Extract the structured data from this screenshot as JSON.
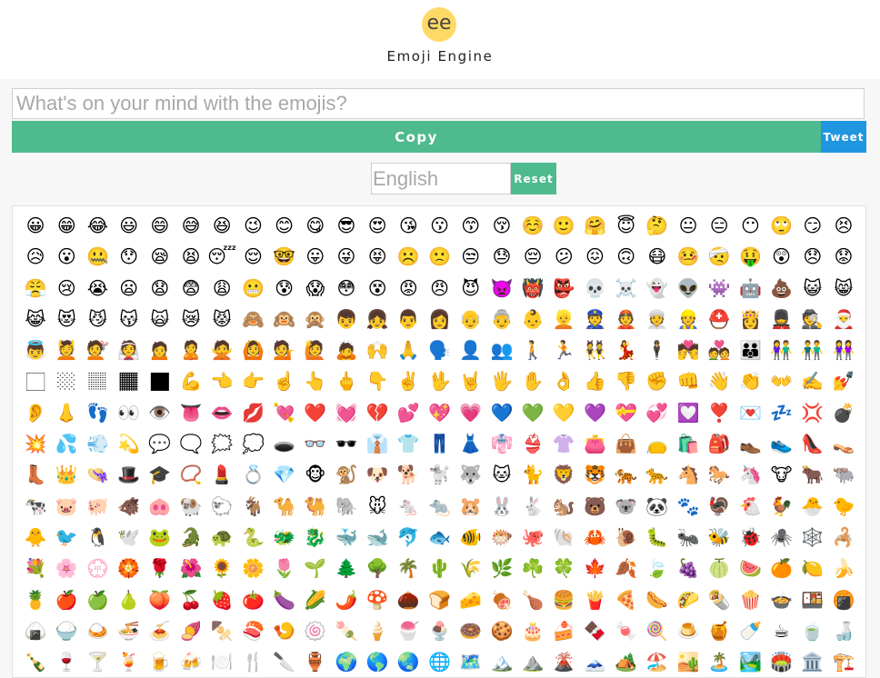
{
  "header": {
    "logo_text": "ee",
    "title": "Emoji Engine"
  },
  "composer": {
    "placeholder": "What's on your mind with the emojis?",
    "copy_label": "Copy",
    "tweet_label": "Tweet"
  },
  "language": {
    "placeholder": "English",
    "reset_label": "Reset"
  },
  "emojis": [
    "😀",
    "😁",
    "😂",
    "😃",
    "😄",
    "😅",
    "😆",
    "😉",
    "😊",
    "😋",
    "😎",
    "😍",
    "😘",
    "😗",
    "😙",
    "😚",
    "☺️",
    "🙂",
    "🤗",
    "😇",
    "🤔",
    "😐",
    "😑",
    "😶",
    "🙄",
    "😏",
    "😣",
    "😥",
    "😮",
    "🤐",
    "😯",
    "😪",
    "😫",
    "😴",
    "😌",
    "🤓",
    "😛",
    "😜",
    "😝",
    "☹️",
    "🙁",
    "😒",
    "😓",
    "😔",
    "😕",
    "😖",
    "🙃",
    "😷",
    "🤒",
    "🤕",
    "🤑",
    "😲",
    "😞",
    "😟",
    "😤",
    "😢",
    "😭",
    "😦",
    "😧",
    "😨",
    "😩",
    "😬",
    "😰",
    "😱",
    "😳",
    "😵",
    "😡",
    "😠",
    "😈",
    "👿",
    "👹",
    "👺",
    "💀",
    "☠️",
    "👻",
    "👽",
    "👾",
    "🤖",
    "💩",
    "😺",
    "😸",
    "😹",
    "😻",
    "😼",
    "😽",
    "🙀",
    "😿",
    "😾",
    "🙈",
    "🙉",
    "🙊",
    "👦",
    "👧",
    "👨",
    "👩",
    "👴",
    "👵",
    "👶",
    "👱",
    "👮",
    "👲",
    "👳",
    "👷",
    "⛑️",
    "👸",
    "💂",
    "🕵️",
    "🎅",
    "👼",
    "💆",
    "💇",
    "👰",
    "🙍",
    "🙎",
    "🙅",
    "🙆",
    "💁",
    "🙋",
    "🙇",
    "🙌",
    "🙏",
    "🗣️",
    "👤",
    "👥",
    "🚶",
    "🏃",
    "👯",
    "💃",
    "🕴️",
    "💏",
    "💑",
    "👪",
    "👫",
    "👬",
    "👭",
    "🏻",
    "🏼",
    "🏽",
    "🏾",
    "🏿",
    "💪",
    "👈",
    "👉",
    "☝️",
    "👆",
    "🖕",
    "👇",
    "✌️",
    "🖖",
    "🤘",
    "🖐️",
    "✋",
    "👌",
    "👍",
    "👎",
    "✊",
    "👊",
    "👋",
    "👏",
    "👐",
    "✍️",
    "💅",
    "👂",
    "👃",
    "👣",
    "👀",
    "👁️",
    "👅",
    "👄",
    "💋",
    "💘",
    "❤️",
    "💓",
    "💔",
    "💕",
    "💖",
    "💗",
    "💙",
    "💚",
    "💛",
    "💜",
    "💝",
    "💞",
    "💟",
    "❣️",
    "💌",
    "💤",
    "💢",
    "💣",
    "💥",
    "💦",
    "💨",
    "💫",
    "💬",
    "🗨️",
    "🗯️",
    "💭",
    "🕳️",
    "👓",
    "🕶️",
    "👔",
    "👕",
    "👖",
    "👗",
    "👘",
    "👙",
    "👚",
    "👛",
    "👜",
    "👝",
    "🛍️",
    "🎒",
    "👞",
    "👟",
    "👠",
    "👡",
    "👢",
    "👑",
    "👒",
    "🎩",
    "🎓",
    "📿",
    "💄",
    "💍",
    "💎",
    "🐵",
    "🐒",
    "🐶",
    "🐕",
    "🐩",
    "🐺",
    "🐱",
    "🐈",
    "🦁",
    "🐯",
    "🐅",
    "🐆",
    "🐴",
    "🐎",
    "🦄",
    "🐮",
    "🐂",
    "🐃",
    "🐄",
    "🐷",
    "🐖",
    "🐗",
    "🐽",
    "🐏",
    "🐑",
    "🐐",
    "🐪",
    "🐫",
    "🐘",
    "🐭",
    "🐁",
    "🐀",
    "🐹",
    "🐰",
    "🐇",
    "🐿️",
    "🐻",
    "🐨",
    "🐼",
    "🐾",
    "🦃",
    "🐔",
    "🐓",
    "🐣",
    "🐤",
    "🐥",
    "🐦",
    "🐧",
    "🕊️",
    "🐸",
    "🐊",
    "🐢",
    "🐍",
    "🐲",
    "🐉",
    "🐳",
    "🐋",
    "🐬",
    "🐟",
    "🐠",
    "🐡",
    "🐙",
    "🐚",
    "🦀",
    "🐌",
    "🐛",
    "🐜",
    "🐝",
    "🐞",
    "🕷️",
    "🕸️",
    "🦂",
    "💐",
    "🌸",
    "💮",
    "🏵️",
    "🌹",
    "🌺",
    "🌻",
    "🌼",
    "🌷",
    "🌱",
    "🌲",
    "🌳",
    "🌴",
    "🌵",
    "🌾",
    "🌿",
    "☘️",
    "🍀",
    "🍁",
    "🍂",
    "🍃",
    "🍇",
    "🍈",
    "🍉",
    "🍊",
    "🍋",
    "🍌",
    "🍍",
    "🍎",
    "🍏",
    "🍐",
    "🍑",
    "🍒",
    "🍓",
    "🍅",
    "🍆",
    "🌽",
    "🌶️",
    "🍄",
    "🌰",
    "🍞",
    "🧀",
    "🍖",
    "🍗",
    "🍔",
    "🍟",
    "🍕",
    "🌭",
    "🌮",
    "🌯",
    "🍿",
    "🍲",
    "🍱",
    "🍘",
    "🍙",
    "🍚",
    "🍛",
    "🍜",
    "🍝",
    "🍠",
    "🍢",
    "🍣",
    "🍤",
    "🍥",
    "🍡",
    "🍦",
    "🍧",
    "🍨",
    "🍩",
    "🍪",
    "🎂",
    "🍰",
    "🍫",
    "🍬",
    "🍭",
    "🍮",
    "🍯",
    "🍼",
    "☕",
    "🍵",
    "🍶",
    "🍾",
    "🍷",
    "🍸",
    "🍹",
    "🍺",
    "🍻",
    "🍽️",
    "🍴",
    "🔪",
    "🏺",
    "🌍",
    "🌎",
    "🌏",
    "🌐",
    "🗺️",
    "🏔️",
    "⛰️",
    "🌋",
    "🗻",
    "🏕️",
    "🏖️",
    "🏜️",
    "🏝️",
    "🏞️",
    "🏟️",
    "🏛️",
    "🏗️"
  ],
  "colors": {
    "accent_green": "#4fba8e",
    "tweet_blue": "#2196e0",
    "logo_yellow": "#ffd966"
  }
}
